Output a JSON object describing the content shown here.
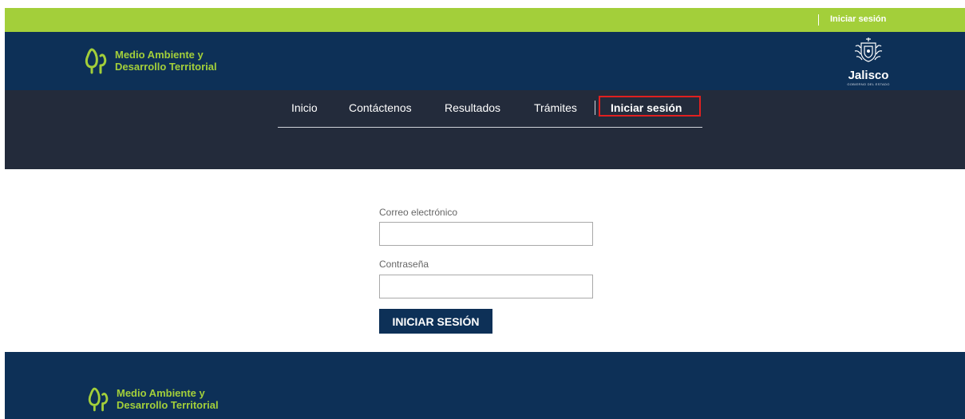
{
  "topbar": {
    "login_link": "Iniciar sesión"
  },
  "header": {
    "logo": {
      "line1": "Medio Ambiente y",
      "line2": "Desarrollo Territorial",
      "icon": "trees-icon"
    },
    "state_logo": {
      "name": "Jalisco",
      "sub": "GOBIERNO DEL ESTADO",
      "icon": "coat-of-arms-icon"
    }
  },
  "nav": {
    "items": [
      {
        "label": "Inicio"
      },
      {
        "label": "Contáctenos"
      },
      {
        "label": "Resultados"
      },
      {
        "label": "Trámites"
      },
      {
        "label": "Iniciar sesión"
      }
    ],
    "active_index": 4
  },
  "login_form": {
    "email_label": "Correo electrónico",
    "email_value": "",
    "password_label": "Contraseña",
    "password_value": "",
    "submit_label": "INICIAR SESIÓN"
  },
  "footer": {
    "logo": {
      "line1": "Medio Ambiente y",
      "line2": "Desarrollo Territorial"
    }
  },
  "colors": {
    "accent_green": "#a3cf3a",
    "header_navy": "#0d3057",
    "nav_dark": "#232b3b",
    "highlight_red": "#e02020"
  }
}
